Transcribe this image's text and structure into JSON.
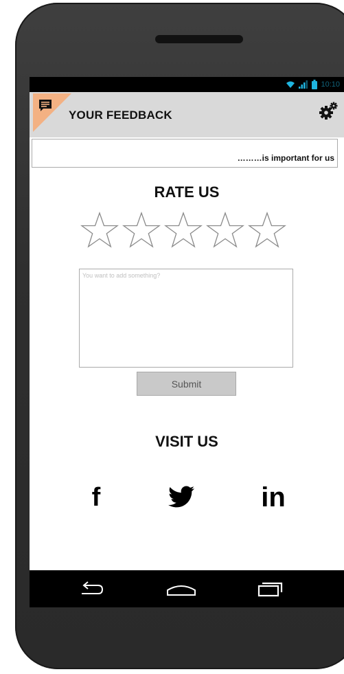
{
  "status_bar": {
    "time": "10:10",
    "icons": [
      "wifi-icon",
      "signal-icon",
      "battery-icon"
    ]
  },
  "header": {
    "title": "YOUR FEEDBACK",
    "left_icon": "feedback-chat-icon",
    "right_icon": "settings-gear-icon",
    "accent_color": "#f3b183",
    "background": "#d9d9d9"
  },
  "subtitle": {
    "text": "………is important for us"
  },
  "rating": {
    "title": "RATE US",
    "max_stars": 5,
    "selected": 0
  },
  "comment": {
    "placeholder": "You want to add something?",
    "value": ""
  },
  "submit": {
    "label": "Submit"
  },
  "visit": {
    "title": "VISIT US",
    "links": [
      {
        "name": "facebook",
        "glyph": "f"
      },
      {
        "name": "twitter",
        "glyph": ""
      },
      {
        "name": "linkedin",
        "glyph": "in"
      }
    ]
  },
  "nav_bar": {
    "buttons": [
      "back-icon",
      "home-icon",
      "recent-apps-icon"
    ]
  }
}
